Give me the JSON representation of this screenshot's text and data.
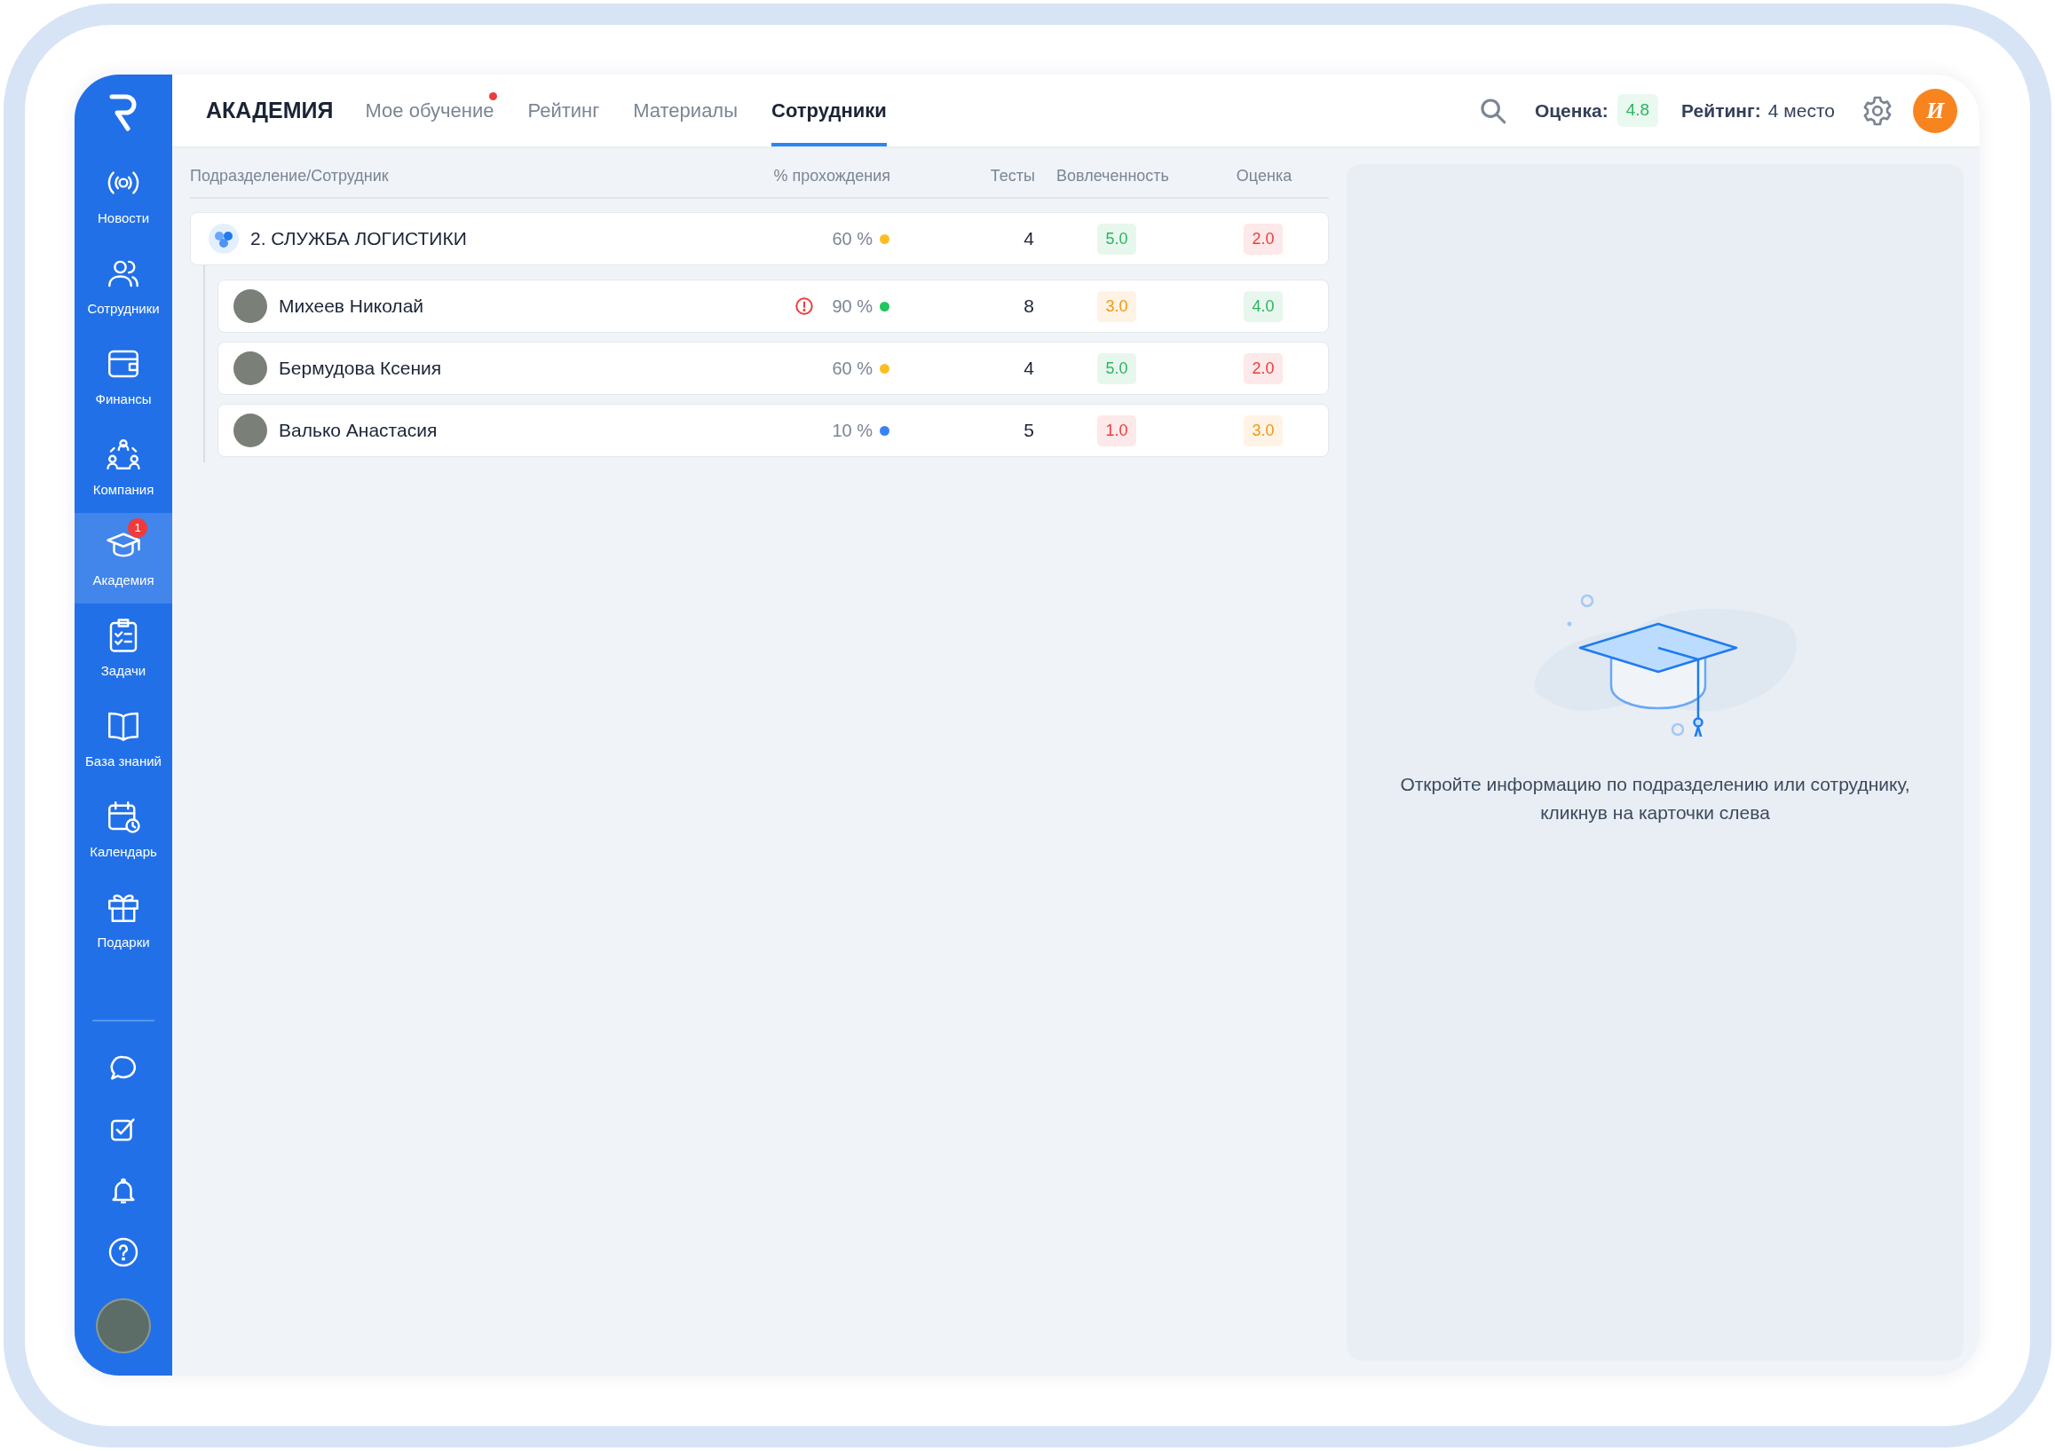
{
  "sidebar": {
    "items": [
      {
        "label": "Новости",
        "selected": false
      },
      {
        "label": "Сотрудники",
        "selected": false
      },
      {
        "label": "Финансы",
        "selected": false
      },
      {
        "label": "Компания",
        "selected": false
      },
      {
        "label": "Академия",
        "selected": true,
        "badge": "1"
      },
      {
        "label": "Задачи",
        "selected": false
      },
      {
        "label": "База знаний",
        "selected": false
      },
      {
        "label": "Календарь",
        "selected": false
      },
      {
        "label": "Подарки",
        "selected": false
      }
    ]
  },
  "header": {
    "title": "АКАДЕМИЯ",
    "tabs": [
      {
        "label": "Мое обучение",
        "selected": false,
        "notify": true
      },
      {
        "label": "Рейтинг",
        "selected": false,
        "notify": false
      },
      {
        "label": "Материалы",
        "selected": false,
        "notify": false
      },
      {
        "label": "Сотрудники",
        "selected": true,
        "notify": false
      }
    ],
    "score_label": "Оценка:",
    "score": "4.8",
    "rating_label": "Рейтинг:",
    "rating": "4 место",
    "user_initial": "И"
  },
  "table": {
    "columns": [
      "Подразделение/Сотрудник",
      "% прохождения",
      "Тесты",
      "Вовлеченность",
      "Оценка"
    ],
    "group": {
      "name": "2. СЛУЖБА ЛОГИСТИКИ",
      "warning": false,
      "percent": "60 %",
      "color": "#fbbf24",
      "tests": "4",
      "engagement": {
        "value": "5.0",
        "color": "#2bb55f"
      },
      "rating": {
        "value": "2.0",
        "color": "#ef3b3b"
      }
    },
    "rows": [
      {
        "name": "Михеев Николай",
        "warning": true,
        "percent": "90 %",
        "color": "#22c55e",
        "tests": "8",
        "engagement": {
          "value": "3.0",
          "color": "#f5960f"
        },
        "rating": {
          "value": "4.0",
          "color": "#2bb55f"
        }
      },
      {
        "name": "Бермудова Ксения",
        "warning": false,
        "percent": "60 %",
        "color": "#fbbf24",
        "tests": "4",
        "engagement": {
          "value": "5.0",
          "color": "#2bb55f"
        },
        "rating": {
          "value": "2.0",
          "color": "#ef3b3b"
        }
      },
      {
        "name": "Валько Анастасия",
        "warning": false,
        "percent": "10 %",
        "color": "#3b82f6",
        "tests": "5",
        "engagement": {
          "value": "1.0",
          "color": "#ef3b3b"
        },
        "rating": {
          "value": "3.0",
          "color": "#f5960f"
        }
      }
    ]
  },
  "empty_state": {
    "message": "Откройте информацию по подразделению или сотруднику, кликнув на карточки слева"
  }
}
